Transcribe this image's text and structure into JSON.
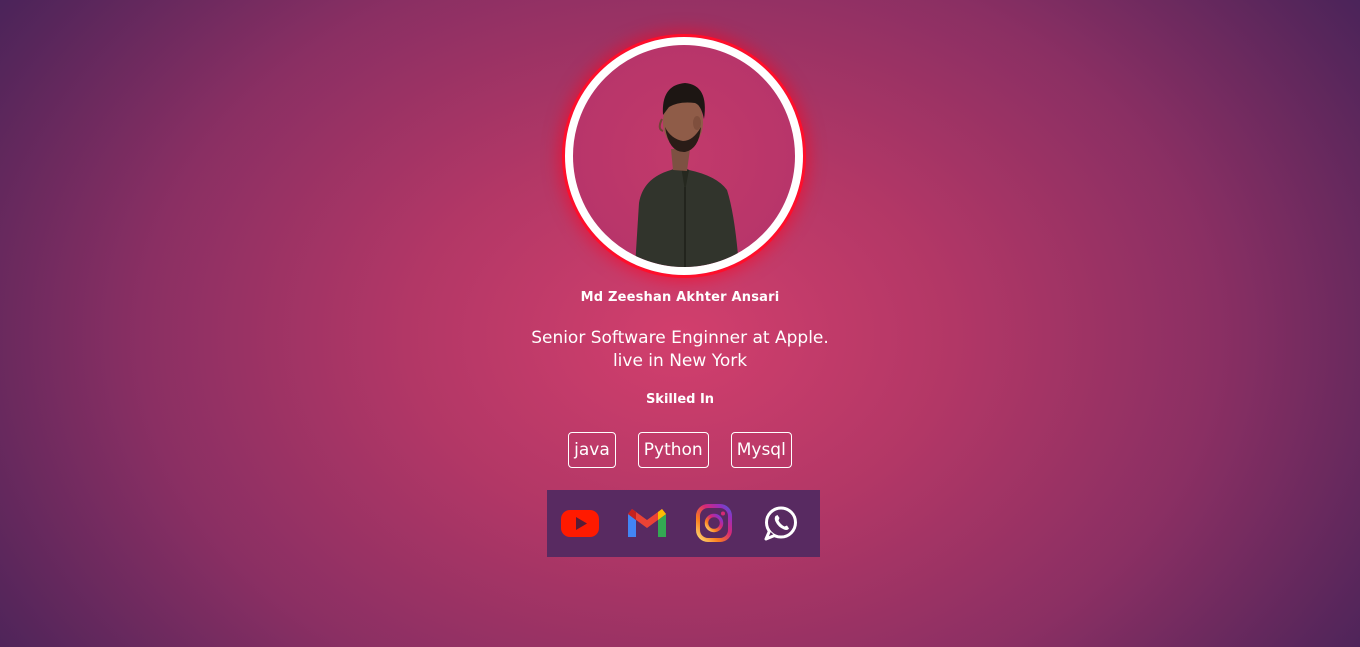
{
  "profile": {
    "name": "Md Zeeshan Akhter Ansari",
    "bio_line1": "Senior Software Enginner at Apple.",
    "bio_line2": "live in New York",
    "skills_heading": "Skilled In",
    "skills": [
      "java",
      "Python",
      "Mysql"
    ]
  },
  "social": {
    "items": [
      {
        "icon": "youtube-icon",
        "color": "#ff0000"
      },
      {
        "icon": "gmail-icon",
        "color": "#ea4335"
      },
      {
        "icon": "instagram-icon",
        "color": "#c13584"
      },
      {
        "icon": "whatsapp-icon",
        "color": "#ffffff"
      }
    ]
  },
  "colors": {
    "ring": "#ffffff",
    "ring_glow": "#ff0e2b",
    "social_bar": "#582a61"
  }
}
